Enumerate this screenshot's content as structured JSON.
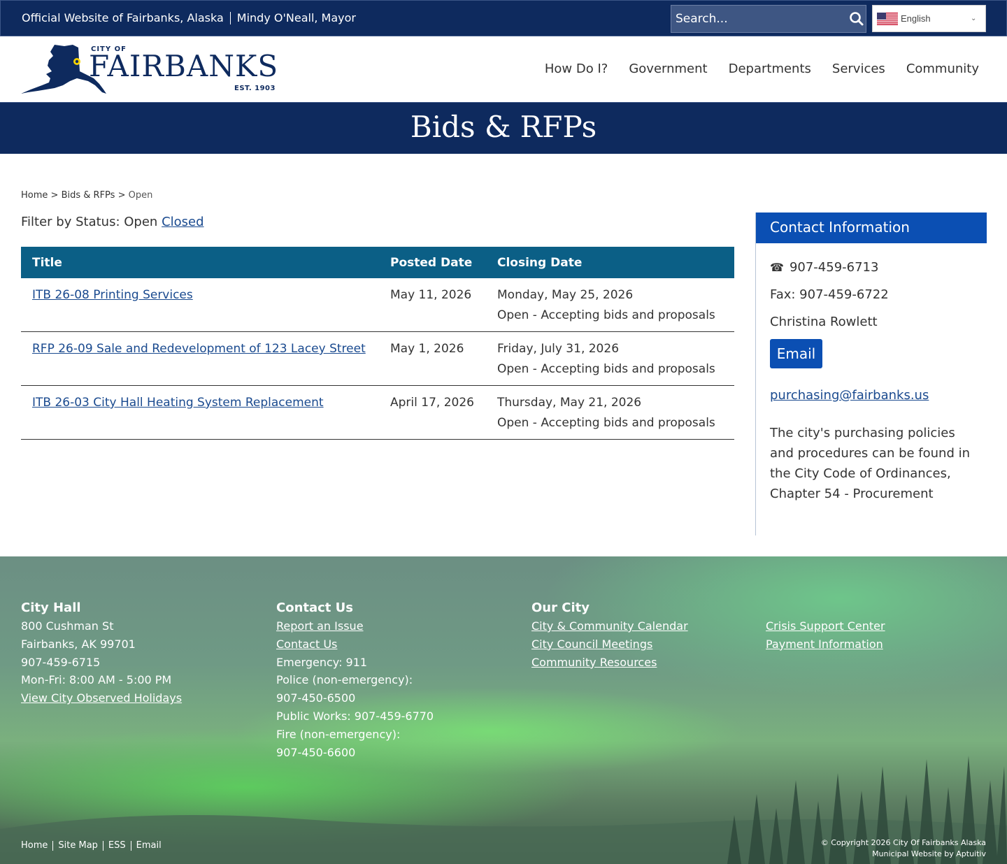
{
  "topbar": {
    "official": "Official Website of Fairbanks, Alaska",
    "mayor": "Mindy O'Neall, Mayor",
    "search_placeholder": "Search...",
    "language": "English"
  },
  "logo": {
    "city_of": "CITY OF",
    "name": "FAIRBANKS",
    "est": "EST. 1903"
  },
  "nav": {
    "items": [
      "How Do I?",
      "Government",
      "Departments",
      "Services",
      "Community"
    ]
  },
  "page": {
    "title": "Bids & RFPs"
  },
  "breadcrumb": {
    "home": "Home",
    "section": "Bids & RFPs",
    "current": "Open",
    "separator": ">"
  },
  "filter": {
    "label": "Filter by Status:",
    "open": "Open",
    "closed": "Closed"
  },
  "table": {
    "headers": [
      "Title",
      "Posted Date",
      "Closing Date"
    ],
    "rows": [
      {
        "title": "ITB 26-08 Printing Services",
        "posted": "May 11, 2026",
        "closing": "Monday, May 25, 2026",
        "status": "Open - Accepting bids and proposals"
      },
      {
        "title": "RFP 26-09 Sale and Redevelopment of 123 Lacey Street",
        "posted": "May 1, 2026",
        "closing": "Friday, July 31, 2026",
        "status": "Open - Accepting bids and proposals"
      },
      {
        "title": "ITB 26-03 City Hall Heating System Replacement",
        "posted": "April 17, 2026",
        "closing": "Thursday, May 21, 2026",
        "status": "Open - Accepting bids and proposals"
      }
    ]
  },
  "sidebar": {
    "heading": "Contact Information",
    "phone_icon": "☎",
    "phone": "907-459-6713",
    "fax": "Fax: 907-459-6722",
    "contact_name": "Christina Rowlett",
    "email_button": "Email",
    "email": "purchasing@fairbanks.us",
    "policy": "The city's purchasing policies and procedures can be found in the City Code of Ordinances, Chapter 54 - Procurement"
  },
  "footer": {
    "city_hall": {
      "heading": "City Hall",
      "address1": "800 Cushman St",
      "address2": "Fairbanks, AK 99701",
      "phone": "907-459-6715",
      "hours": "Mon-Fri: 8:00 AM - 5:00 PM",
      "holidays_link": "View City Observed Holidays"
    },
    "contact": {
      "heading": "Contact Us",
      "report_link": "Report an Issue",
      "contact_link": "Contact Us",
      "emergency": "Emergency: 911",
      "police_label": "Police (non-emergency):",
      "police_phone": "907-450-6500",
      "public_works": "Public Works: 907-459-6770",
      "fire_label": "Fire (non-emergency):",
      "fire_phone": "907-450-6600"
    },
    "our_city": {
      "heading": "Our City",
      "links": [
        "City & Community Calendar",
        "City Council Meetings",
        "Community Resources"
      ]
    },
    "more": {
      "links": [
        "Crisis Support Center",
        "Payment Information"
      ]
    },
    "bottom_links": [
      "Home",
      "Site Map",
      "ESS",
      "Email"
    ],
    "copyright": "© Copyright 2026 City Of Fairbanks Alaska",
    "credit": "Municipal Website by Aptuitiv"
  },
  "colors": {
    "navy": "#0e2a5e",
    "table_header": "#0b5f86",
    "sidebar_accent": "#0b4fb3",
    "link": "#1a4a8f"
  },
  "icons": {
    "search": "search-icon",
    "phone": "phone-icon",
    "flag": "us-flag-icon",
    "chevron": "chevron-down-icon",
    "logo_map": "alaska-map-icon"
  }
}
